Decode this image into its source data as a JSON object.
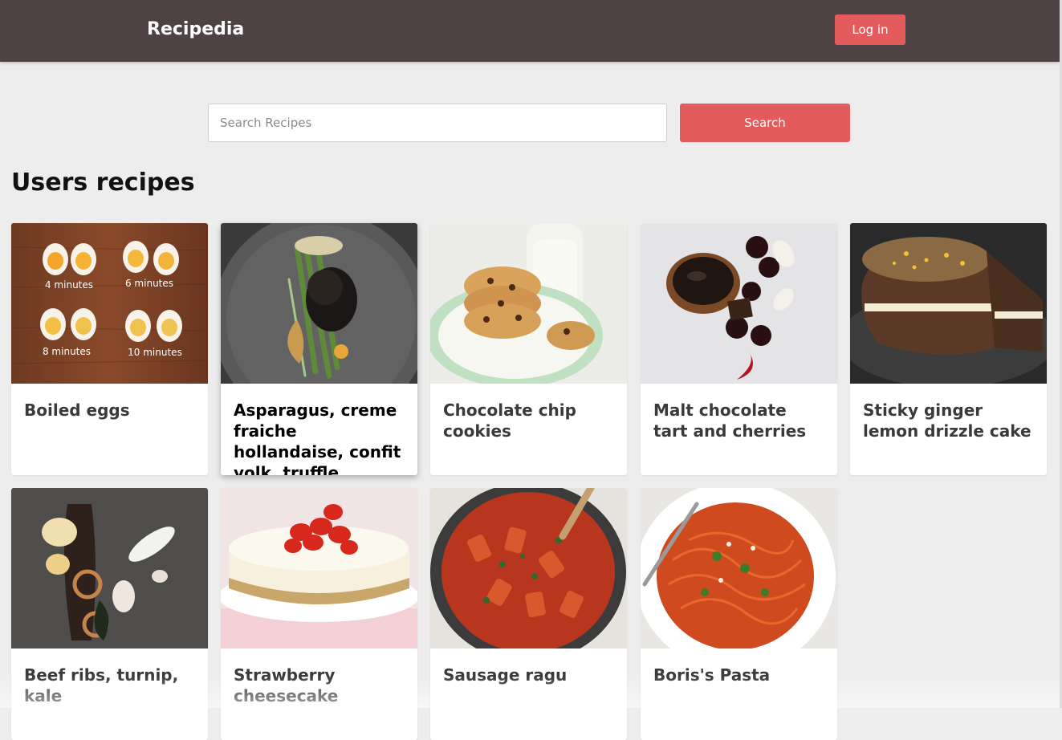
{
  "app": {
    "brand": "Recipedia",
    "login_label": "Log in"
  },
  "search": {
    "placeholder": "Search Recipes",
    "value": "",
    "button_label": "Search"
  },
  "section": {
    "title": "Users recipes"
  },
  "colors": {
    "navbar": "#4f4244",
    "accent": "#e35b5d",
    "background": "#eeeded"
  },
  "recipes": [
    {
      "title": "Boiled eggs"
    },
    {
      "title": "Asparagus, creme fraiche hollandaise, confit yolk, truffle."
    },
    {
      "title": "Chocolate chip cookies"
    },
    {
      "title": "Malt chocolate tart and cherries"
    },
    {
      "title": "Sticky ginger lemon drizzle cake"
    },
    {
      "title": "Beef ribs, turnip, kale"
    },
    {
      "title": "Strawberry cheesecake"
    },
    {
      "title": "Sausage ragu"
    },
    {
      "title": "Boris's Pasta"
    }
  ],
  "egg_labels": [
    "4 minutes",
    "6 minutes",
    "8 minutes",
    "10 minutes"
  ]
}
